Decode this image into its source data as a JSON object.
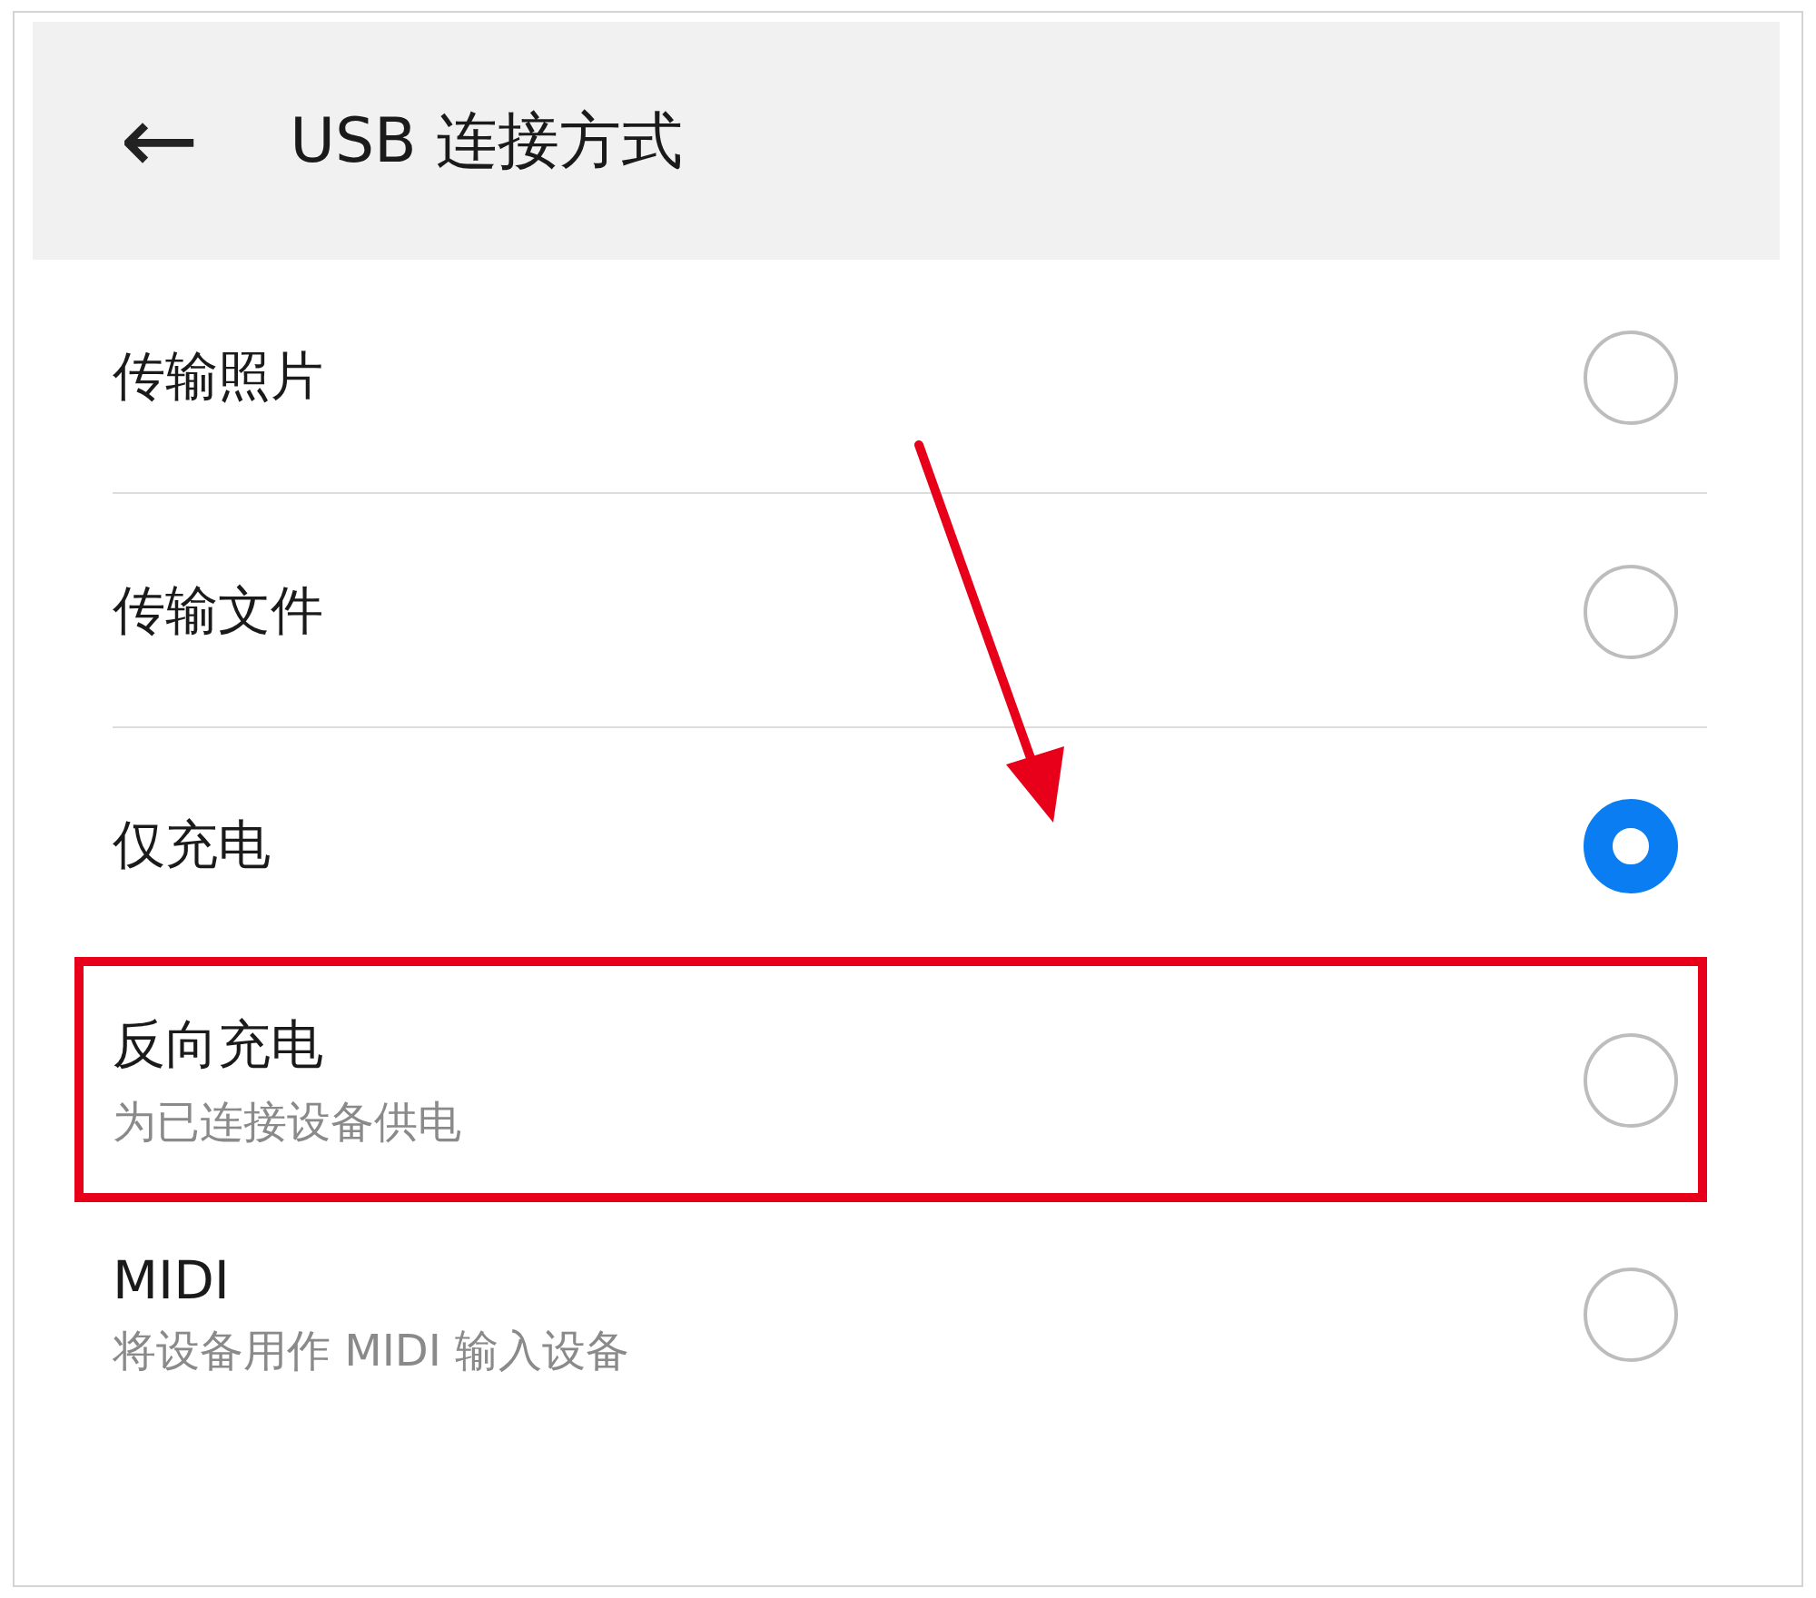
{
  "header": {
    "back": "←",
    "title": "USB 连接方式"
  },
  "options": [
    {
      "label": "传输照片",
      "selected": false,
      "divider_below": true,
      "highlighted": false
    },
    {
      "label": "传输文件",
      "selected": false,
      "divider_below": true,
      "highlighted": false
    },
    {
      "label": "仅充电",
      "selected": true,
      "divider_below": false,
      "highlighted": false
    },
    {
      "label": "反向充电",
      "subtitle": "为已连接设备供电",
      "selected": false,
      "divider_below": false,
      "highlighted": true
    },
    {
      "label": "MIDI",
      "subtitle": "将设备用作 MIDI 输入设备",
      "selected": false,
      "divider_below": false,
      "highlighted": false
    }
  ]
}
